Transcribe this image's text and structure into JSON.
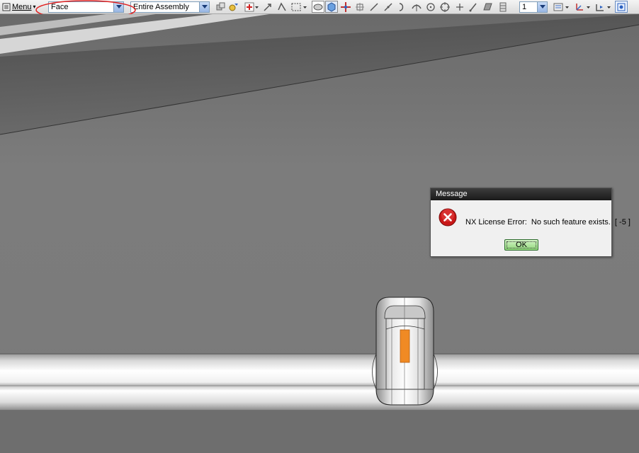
{
  "toolbar": {
    "menu_label": "Menu",
    "filter_value": "Face",
    "scope_value": "Entire Assembly",
    "layer_value": "1",
    "icons": [
      "menu-icon",
      "measure-icon",
      "snap-icon",
      "select-point-icon",
      "arrow-icon",
      "lasso-icon",
      "box-select-icon",
      "shaded-view-icon",
      "wireframe-view-icon",
      "move-icon",
      "rotate-icon",
      "line-icon",
      "curve-icon",
      "arc-icon",
      "center-icon",
      "circle-icon",
      "crosshair-icon",
      "slash-icon",
      "face-icon",
      "stack-icon",
      "layer-settings-icon",
      "wcs-icon",
      "view-triad-icon",
      "fit-view-icon"
    ]
  },
  "viewport": {
    "background_color": "#7a7a7a",
    "highlight_color": "#f08a24"
  },
  "dialog": {
    "title": "Message",
    "message": "NX License Error:  No such feature exists.  [ -5 ]",
    "ok_label": "OK",
    "icon": "error-icon"
  }
}
